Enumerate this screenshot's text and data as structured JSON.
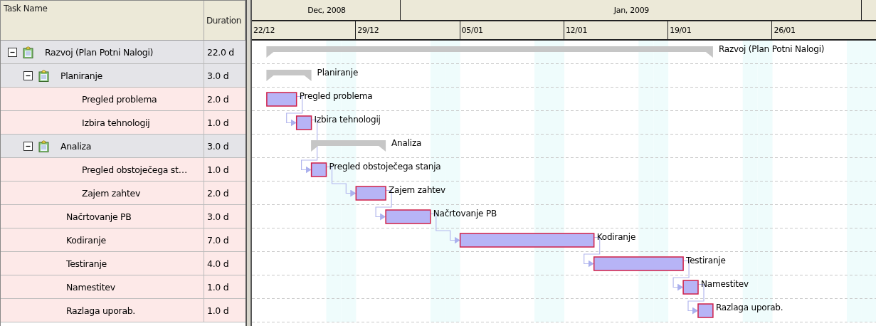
{
  "columns": [
    {
      "label": "Task Name"
    },
    {
      "label": "Duration"
    }
  ],
  "timescale": {
    "months": [
      {
        "label": "Dec, 2008"
      },
      {
        "label": "Jan, 2009"
      }
    ],
    "weeks": [
      "22/12",
      "29/12",
      "05/01",
      "12/01",
      "19/01",
      "26/01"
    ]
  },
  "tasks": [
    {
      "kind": "summary",
      "name": "Razvoj (Plan Potni Nalogi)",
      "duration": "22.0 d",
      "bar_label": "Razvoj (Plan Potni Nalogi)",
      "expanded": true,
      "children": [
        {
          "kind": "summary",
          "name": "Planiranje",
          "duration": "3.0 d",
          "bar_label": "Planiranje",
          "expanded": true,
          "children": [
            {
              "kind": "task",
              "name": "Pregled problema",
              "duration": "2.0 d",
              "bar_label": "Pregled problema",
              "linked": false
            },
            {
              "kind": "task",
              "name": "Izbira tehnologij",
              "duration": "1.0 d",
              "bar_label": "Izbira tehnologij",
              "linked": true
            }
          ]
        },
        {
          "kind": "summary",
          "name": "Analiza",
          "duration": "3.0 d",
          "bar_label": "Analiza",
          "expanded": true,
          "children": [
            {
              "kind": "task",
              "name": "Pregled obstoječega st…",
              "duration": "1.0 d",
              "bar_label": "Pregled obstoječega stanja",
              "linked": true
            },
            {
              "kind": "task",
              "name": "Zajem zahtev",
              "duration": "2.0 d",
              "bar_label": "Zajem zahtev",
              "linked": true
            }
          ]
        },
        {
          "kind": "task",
          "name": "Načrtovanje PB",
          "duration": "3.0 d",
          "bar_label": "Načrtovanje PB",
          "linked": true
        },
        {
          "kind": "task",
          "name": "Kodiranje",
          "duration": "7.0 d",
          "bar_label": "Kodiranje",
          "linked": true
        },
        {
          "kind": "task",
          "name": "Testiranje",
          "duration": "4.0 d",
          "bar_label": "Testiranje",
          "linked": true
        },
        {
          "kind": "task",
          "name": "Namestitev",
          "duration": "1.0 d",
          "bar_label": "Namestitev",
          "linked": true
        },
        {
          "kind": "task",
          "name": "Razlaga uporab.",
          "duration": "1.0 d",
          "bar_label": "Razlaga uporab.",
          "linked": true
        }
      ]
    }
  ]
}
